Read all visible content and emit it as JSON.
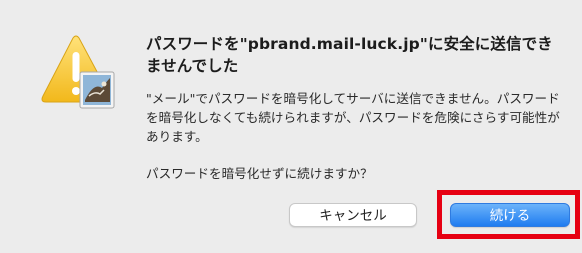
{
  "dialog": {
    "title": "パスワードを\"pbrand.mail-luck.jp\"に安全に送信できませんでした",
    "message": "\"メール\"でパスワードを暗号化してサーバに送信できません。パスワードを暗号化しなくても続けられますが、パスワードを危険にさらす可能性があります。",
    "question": "パスワードを暗号化せずに続けますか？",
    "icon": "warning-triangle-with-mail-stamp-icon"
  },
  "buttons": {
    "cancel_label": "キャンセル",
    "continue_label": "続ける"
  },
  "colors": {
    "background": "#ececec",
    "primary_button": "#2a85f5",
    "highlight": "#e60012",
    "warning_yellow": "#f7c531"
  }
}
